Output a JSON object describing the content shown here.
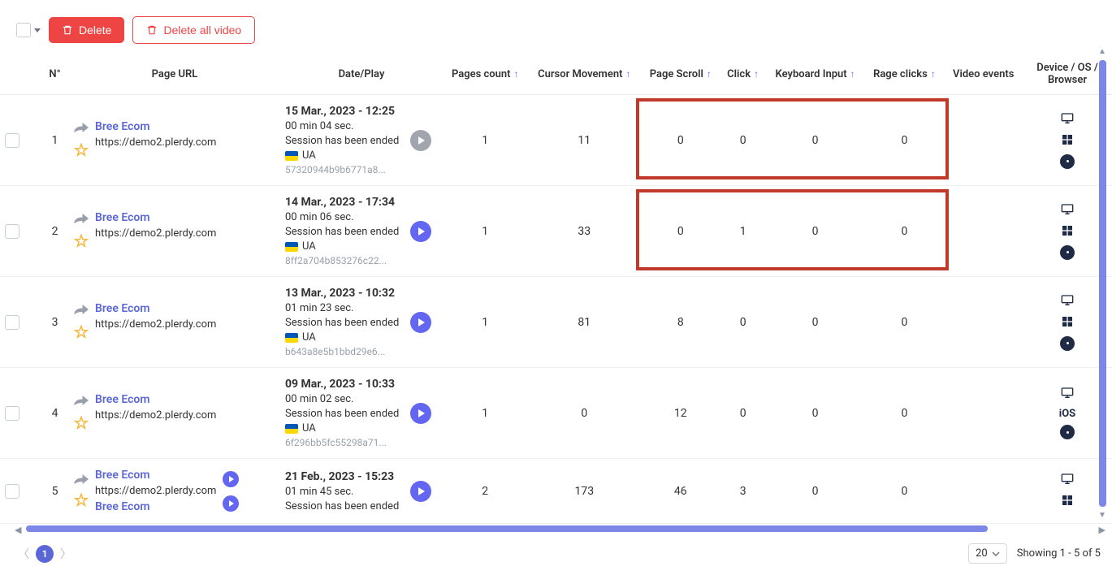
{
  "toolbar": {
    "delete_label": "Delete",
    "delete_all_label": "Delete all video"
  },
  "columns": {
    "num": "N°",
    "page_url": "Page URL",
    "date_play": "Date/Play",
    "pages_count": "Pages count",
    "cursor_movement": "Cursor Movement",
    "page_scroll": "Page Scroll",
    "click": "Click",
    "keyboard_input": "Keyboard Input",
    "rage_clicks": "Rage clicks",
    "video_events": "Video events",
    "device": "Device / OS / Browser"
  },
  "rows": [
    {
      "num": "1",
      "name": "Bree Ecom",
      "url": "https://demo2.plerdy.com",
      "date": "15 Mar., 2023 - 12:25",
      "duration": "00 min 04 sec.",
      "status": "Session has been ended",
      "country": "UA",
      "hash": "57320944b9b6771a8...",
      "play_gray": true,
      "pages": "1",
      "cursor": "11",
      "scroll": "0",
      "click": "0",
      "keyboard": "0",
      "rage": "0",
      "device": "desktop-win-chrome"
    },
    {
      "num": "2",
      "name": "Bree Ecom",
      "url": "https://demo2.plerdy.com",
      "date": "14 Mar., 2023 - 17:34",
      "duration": "00 min 06 sec.",
      "status": "Session has been ended",
      "country": "UA",
      "hash": "8ff2a704b853276c22...",
      "play_gray": false,
      "pages": "1",
      "cursor": "33",
      "scroll": "0",
      "click": "1",
      "keyboard": "0",
      "rage": "0",
      "device": "desktop-win-chrome"
    },
    {
      "num": "3",
      "name": "Bree Ecom",
      "url": "https://demo2.plerdy.com",
      "date": "13 Mar., 2023 - 10:32",
      "duration": "01 min 23 sec.",
      "status": "Session has been ended",
      "country": "UA",
      "hash": "b643a8e5b1bbd29e6...",
      "play_gray": false,
      "pages": "1",
      "cursor": "81",
      "scroll": "8",
      "click": "0",
      "keyboard": "0",
      "rage": "0",
      "device": "desktop-win-chrome"
    },
    {
      "num": "4",
      "name": "Bree Ecom",
      "url": "https://demo2.plerdy.com",
      "date": "09 Mar., 2023 - 10:33",
      "duration": "00 min 02 sec.",
      "status": "Session has been ended",
      "country": "UA",
      "hash": "6f296bb5fc55298a71...",
      "play_gray": false,
      "pages": "1",
      "cursor": "0",
      "scroll": "12",
      "click": "0",
      "keyboard": "0",
      "rage": "0",
      "device": "desktop-ios-chrome"
    },
    {
      "num": "5",
      "name": "Bree Ecom",
      "url": "https://demo2.plerdy.com",
      "name2": "Bree Ecom",
      "date": "21 Feb., 2023 - 15:23",
      "duration": "01 min 45 sec.",
      "status": "Session has been ended",
      "pages": "2",
      "cursor": "173",
      "scroll": "46",
      "click": "3",
      "keyboard": "0",
      "rage": "0",
      "device": "desktop-win"
    }
  ],
  "footer": {
    "page": "1",
    "page_size": "20",
    "showing": "Showing 1 - 5 of 5"
  }
}
